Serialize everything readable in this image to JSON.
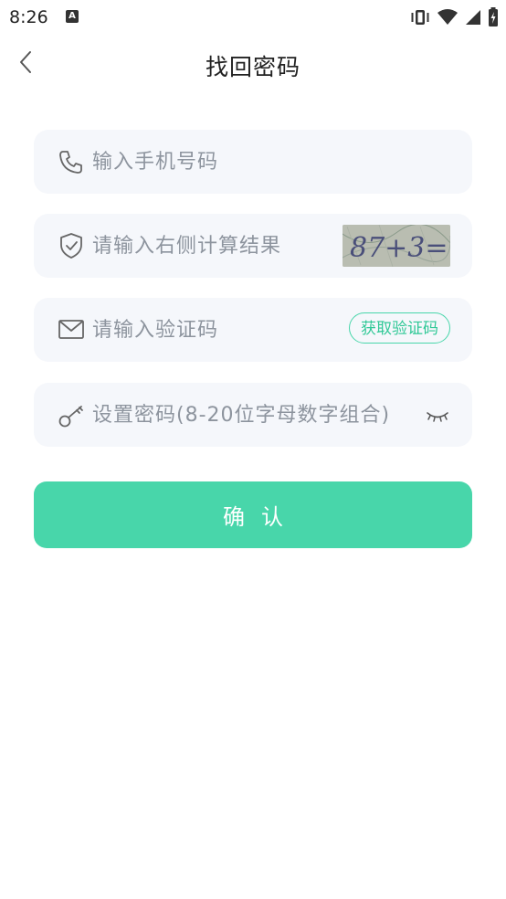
{
  "status_bar": {
    "time": "8:26",
    "app_icon": "A"
  },
  "header": {
    "title": "找回密码",
    "back_icon": "chevron-left-icon"
  },
  "form": {
    "phone": {
      "placeholder": "输入手机号码",
      "value": "",
      "icon": "phone-icon"
    },
    "captcha": {
      "placeholder": "请输入右侧计算结果",
      "value": "",
      "icon": "shield-icon",
      "image_text": "87+3=?"
    },
    "sms": {
      "placeholder": "请输入验证码",
      "value": "",
      "icon": "mail-icon",
      "button_label": "获取验证码"
    },
    "password": {
      "placeholder": "设置密码(8-20位字母数字组合)",
      "value": "",
      "icon": "key-icon",
      "toggle_icon": "eye-closed-icon"
    }
  },
  "confirm_button": {
    "label": "确认"
  },
  "colors": {
    "accent": "#48d6aa",
    "field_bg": "#f5f7fb",
    "placeholder": "#8d949e"
  }
}
